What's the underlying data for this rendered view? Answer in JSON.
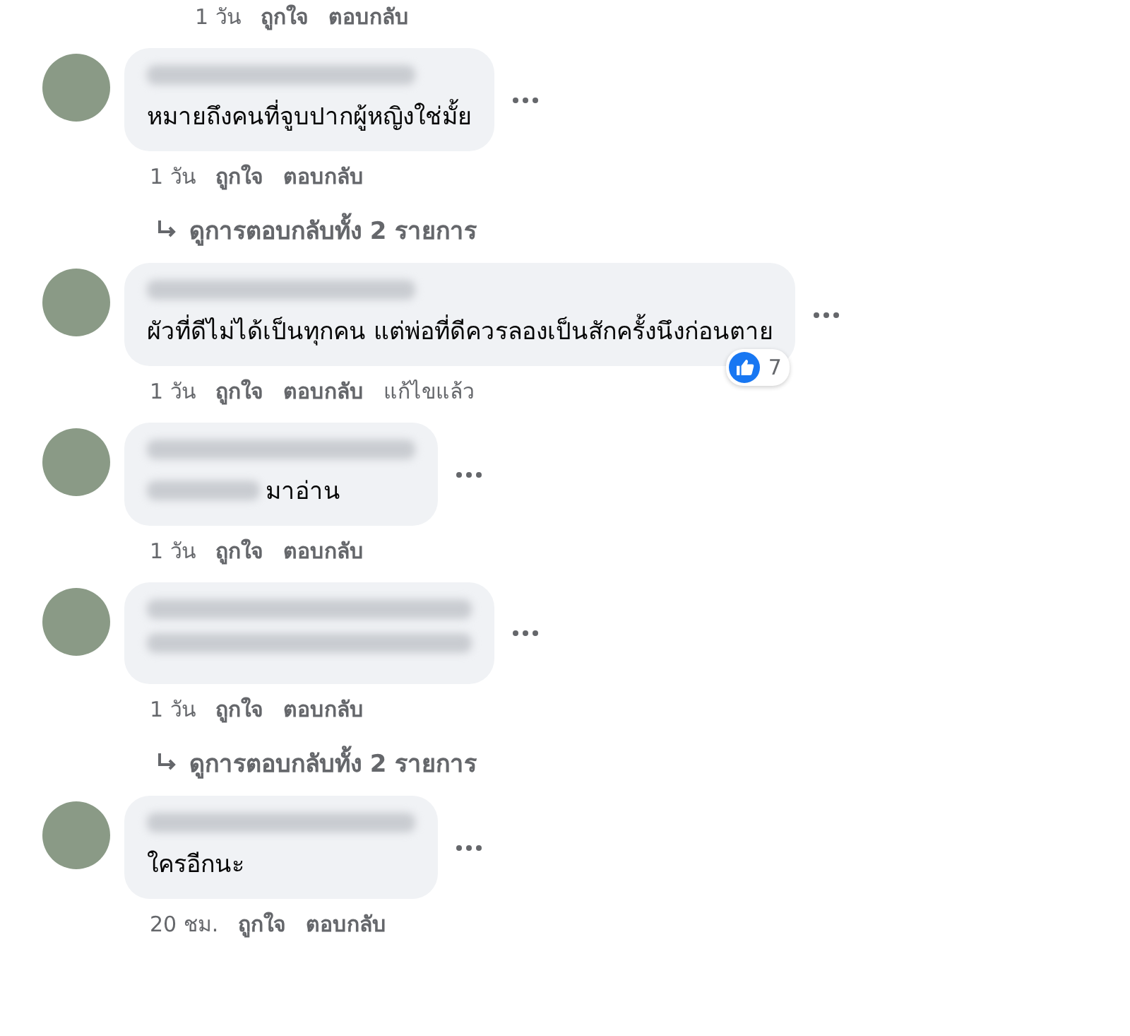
{
  "top_meta": {
    "time": "1 วัน",
    "like": "ถูกใจ",
    "reply": "ตอบกลับ"
  },
  "comments": [
    {
      "kind": "text",
      "text": "หมายถึงคนที่จูบปากผู้หญิงใช่มั้ย",
      "time": "1 วัน",
      "like": "ถูกใจ",
      "reply": "ตอบกลับ",
      "replies": "ดูการตอบกลับทั้ง 2 รายการ"
    },
    {
      "kind": "text",
      "text": "ผัวที่ดีไม่ได้เป็นทุกคน แต่พ่อที่ดีควรลองเป็นสักครั้งนึงก่อนตาย",
      "reactions": "7",
      "time": "1 วัน",
      "like": "ถูกใจ",
      "reply": "ตอบกลับ",
      "edited": "แก้ไขแล้ว"
    },
    {
      "kind": "partly_hidden",
      "text": "มาอ่าน",
      "time": "1 วัน",
      "like": "ถูกใจ",
      "reply": "ตอบกลับ"
    },
    {
      "kind": "hidden",
      "time": "1 วัน",
      "like": "ถูกใจ",
      "reply": "ตอบกลับ",
      "replies": "ดูการตอบกลับทั้ง 2 รายการ"
    },
    {
      "kind": "text",
      "text": "ใครอีกนะ",
      "time": "20 ชม.",
      "like": "ถูกใจ",
      "reply": "ตอบกลับ"
    }
  ]
}
